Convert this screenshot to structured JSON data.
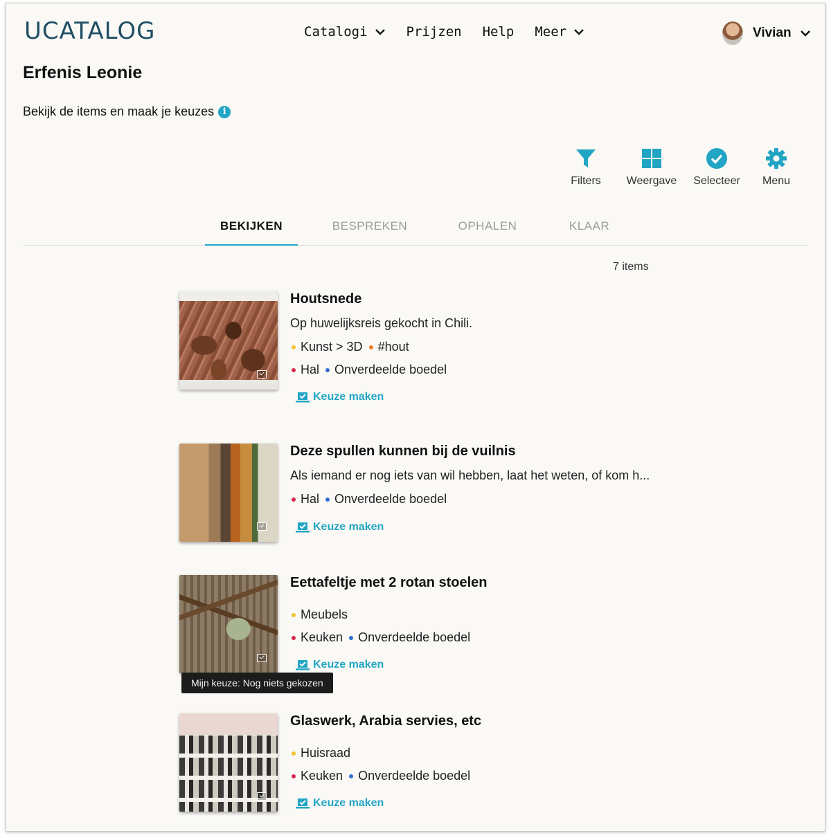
{
  "brand": {
    "logo_text": "UCATALOG",
    "accent_color": "#22a5c4",
    "logo_color": "#1f4e64"
  },
  "nav": {
    "items": [
      {
        "label": "Catalogi",
        "has_dropdown": true
      },
      {
        "label": "Prijzen",
        "has_dropdown": false
      },
      {
        "label": "Help",
        "has_dropdown": false
      },
      {
        "label": "Meer",
        "has_dropdown": true
      }
    ]
  },
  "user": {
    "name": "Vivian",
    "avatar_icon": "user-avatar"
  },
  "page": {
    "title": "Erfenis Leonie",
    "subtitle": "Bekijk de items en maak je keuzes"
  },
  "toolbar": {
    "filters": {
      "label": "Filters",
      "icon": "filter-icon"
    },
    "view": {
      "label": "Weergave",
      "icon": "grid-icon"
    },
    "select": {
      "label": "Selecteer",
      "icon": "check-circle-icon"
    },
    "menu": {
      "label": "Menu",
      "icon": "gear-icon"
    }
  },
  "tabs": [
    {
      "label": "BEKIJKEN",
      "active": true
    },
    {
      "label": "BESPREKEN",
      "active": false
    },
    {
      "label": "OPHALEN",
      "active": false
    },
    {
      "label": "KLAAR",
      "active": false
    }
  ],
  "item_count": "7 items",
  "items": [
    {
      "title": "Houtsnede",
      "description": "Op huwelijksreis gekocht in Chili.",
      "category": "Kunst > 3D",
      "tag": "#hout",
      "location": "Hal",
      "group": "Onverdeelde boedel",
      "choice_label": "Keuze maken"
    },
    {
      "title": "Deze spullen kunnen bij de vuilnis",
      "description": "Als iemand er nog iets van wil hebben, laat het weten, of kom h...",
      "location": "Hal",
      "group": "Onverdeelde boedel",
      "choice_label": "Keuze maken"
    },
    {
      "title": "Eettafeltje met 2 rotan stoelen",
      "category": "Meubels",
      "location": "Keuken",
      "group": "Onverdeelde boedel",
      "choice_label": "Keuze maken"
    },
    {
      "title": "Glaswerk, Arabia servies, etc",
      "category": "Huisraad",
      "location": "Keuken",
      "group": "Onverdeelde boedel",
      "choice_label": "Keuze maken"
    }
  ],
  "tooltip": {
    "text": "Mijn keuze: Nog niets gekozen"
  }
}
